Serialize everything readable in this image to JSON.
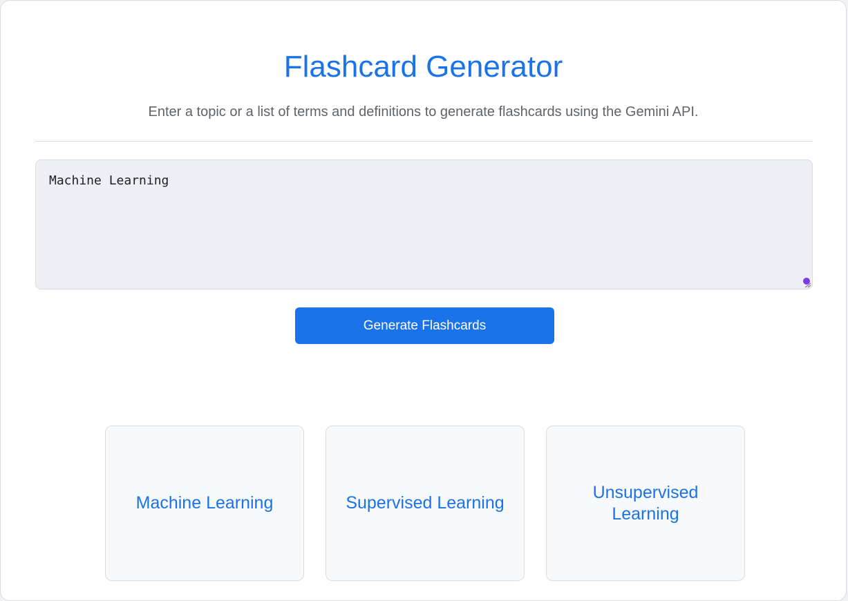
{
  "header": {
    "title": "Flashcard Generator",
    "subtitle": "Enter a topic or a list of terms and definitions to generate flashcards using the Gemini API."
  },
  "input": {
    "value": "Machine Learning"
  },
  "actions": {
    "generate_label": "Generate Flashcards"
  },
  "flashcards": [
    {
      "term": "Machine Learning"
    },
    {
      "term": "Supervised Learning"
    },
    {
      "term": "Unsupervised Learning"
    }
  ],
  "colors": {
    "accent": "#1a73e8",
    "text_secondary": "#5f6368",
    "input_bg": "#eef0f5",
    "card_bg": "#f8f9fa",
    "resize_dot": "#7c3aed"
  }
}
